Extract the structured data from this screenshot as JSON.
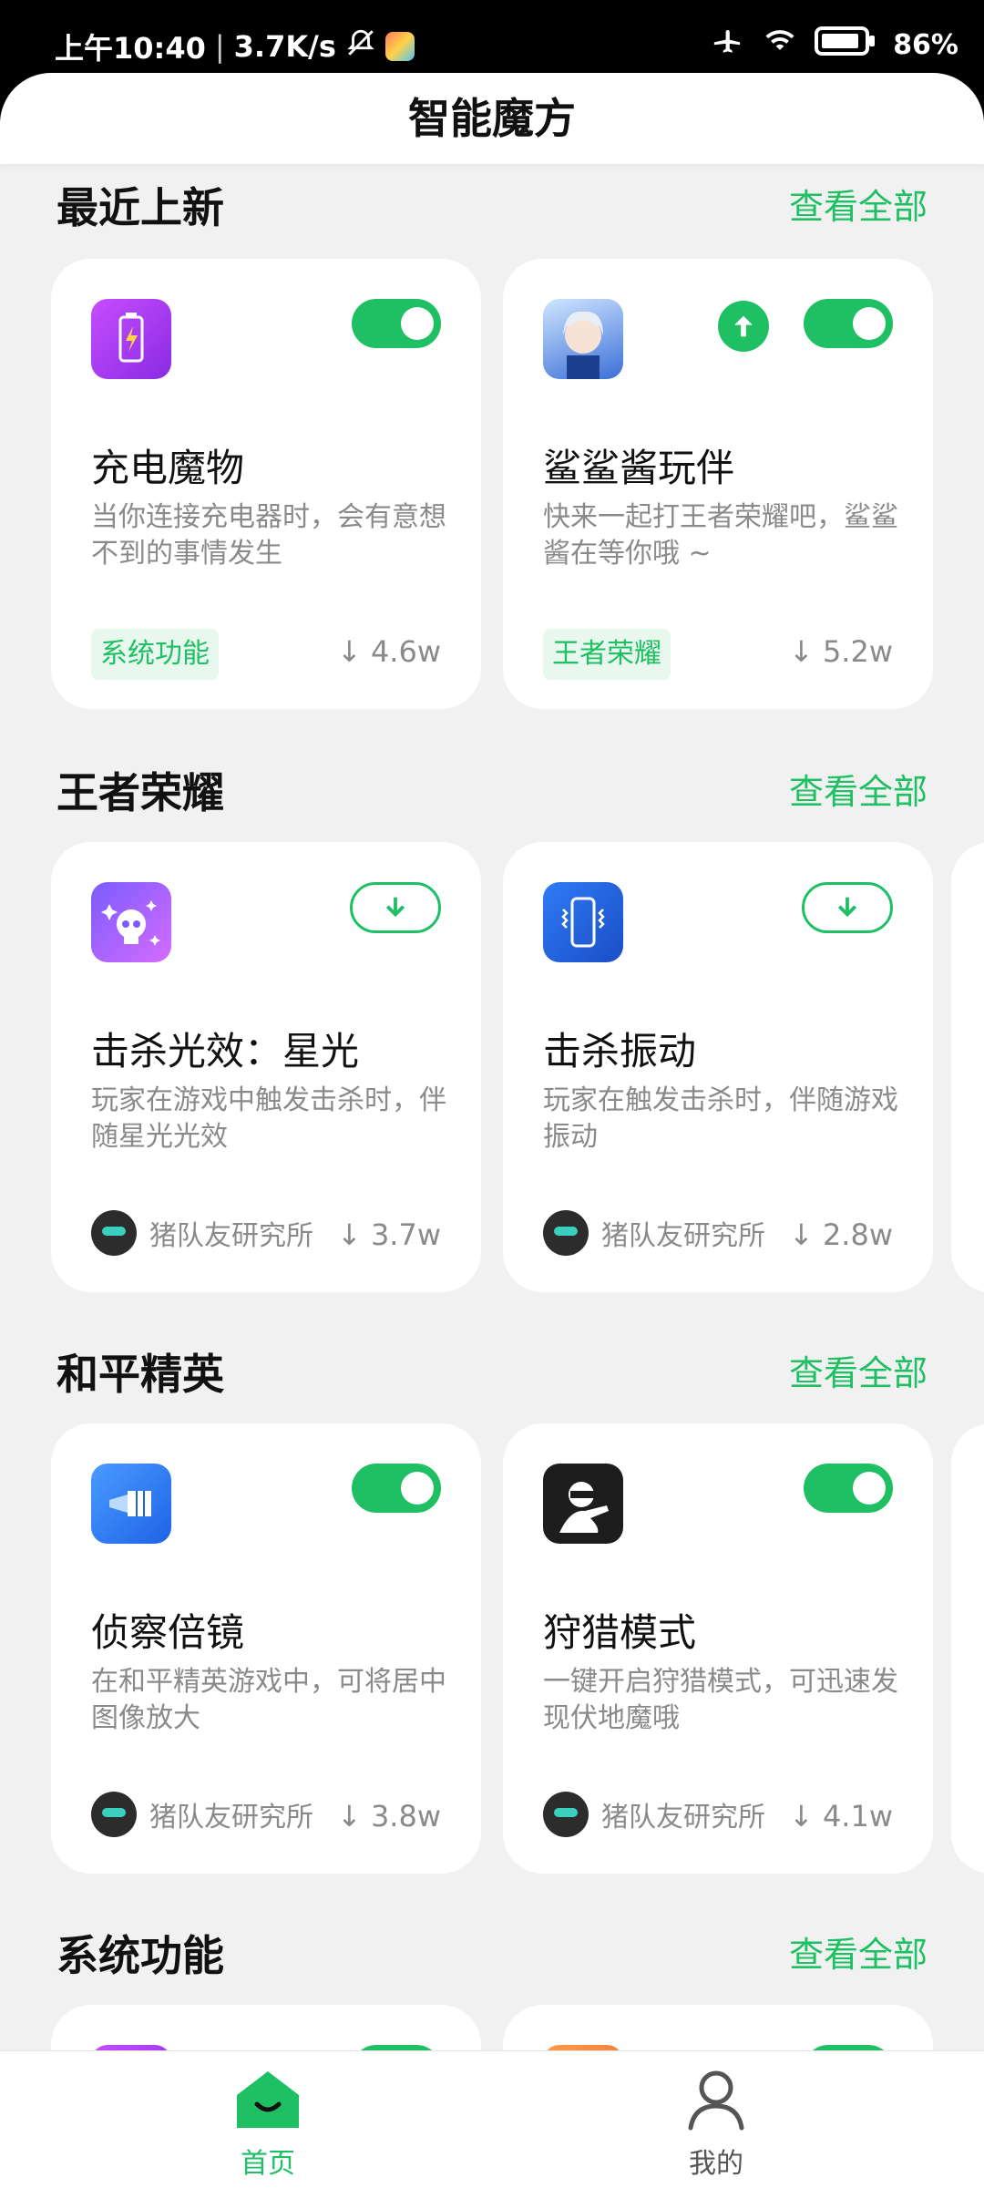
{
  "status_bar": {
    "time": "上午10:40",
    "speed": "3.7K/s",
    "battery": "86%",
    "icons": [
      "mute-bell-icon",
      "app-badge-icon",
      "airplane-icon",
      "wifi-icon",
      "battery-icon"
    ]
  },
  "header": {
    "title": "智能魔方"
  },
  "sections": [
    {
      "title": "最近上新",
      "see_all": "查看全部",
      "cards": [
        {
          "name": "充电魔物",
          "desc": "当你连接充电器时，会有意想不到的事情发生",
          "tag": "系统功能",
          "downloads": "4.6w",
          "control": "toggle-on",
          "icon": "charging-icon"
        },
        {
          "name": "鲨鲨酱玩伴",
          "desc": "快来一起打王者荣耀吧，鲨鲨酱在等你哦 ~",
          "tag": "王者荣耀",
          "downloads": "5.2w",
          "control": "toggle-on",
          "update": true,
          "icon": "anime-character-icon"
        }
      ]
    },
    {
      "title": "王者荣耀",
      "see_all": "查看全部",
      "cards": [
        {
          "name": "击杀光效：星光",
          "desc": "玩家在游戏中触发击杀时，伴随星光光效",
          "author": "猪队友研究所",
          "downloads": "3.7w",
          "control": "download",
          "icon": "skull-sparkle-icon"
        },
        {
          "name": "击杀振动",
          "desc": "玩家在触发击杀时，伴随游戏振动",
          "author": "猪队友研究所",
          "downloads": "2.8w",
          "control": "download",
          "icon": "phone-vibrate-icon"
        }
      ]
    },
    {
      "title": "和平精英",
      "see_all": "查看全部",
      "cards": [
        {
          "name": "侦察倍镜",
          "desc": "在和平精英游戏中，可将居中图像放大",
          "author": "猪队友研究所",
          "downloads": "3.8w",
          "control": "toggle-on",
          "icon": "scope-icon"
        },
        {
          "name": "狩猎模式",
          "desc": "一键开启狩猎模式，可迅速发现伏地魔哦",
          "author": "猪队友研究所",
          "downloads": "4.1w",
          "control": "toggle-on",
          "icon": "hunter-icon"
        }
      ]
    },
    {
      "title": "系统功能",
      "see_all": "查看全部"
    }
  ],
  "bottom_nav": [
    {
      "label": "首页",
      "active": true,
      "icon": "home-icon"
    },
    {
      "label": "我的",
      "active": false,
      "icon": "profile-icon"
    }
  ],
  "colors": {
    "accent": "#1fbf63",
    "background": "#f1f1f1",
    "text_secondary": "#8a8a8a"
  }
}
